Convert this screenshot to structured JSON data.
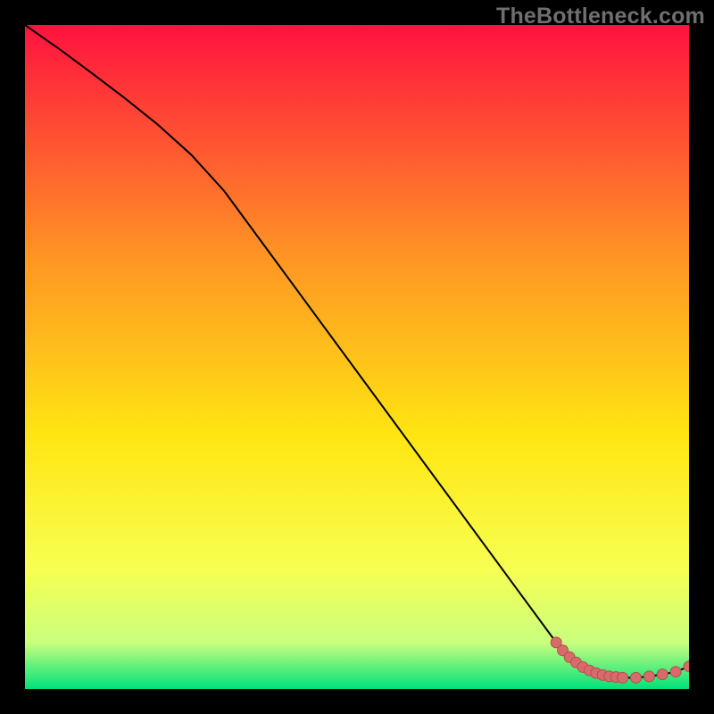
{
  "watermark": "TheBottleneck.com",
  "colors": {
    "gradient_top": "#ff123f",
    "gradient_upper_mid": "#ff9524",
    "gradient_mid": "#ffe612",
    "gradient_lower_mid": "#f7ff52",
    "gradient_low_band": "#c9ff7e",
    "gradient_bottom": "#00e27a",
    "curve": "#000000",
    "marker_fill": "#d76a6a",
    "marker_stroke": "#b94d4d"
  },
  "chart_data": {
    "type": "line",
    "title": "",
    "xlabel": "",
    "ylabel": "",
    "xlim": [
      0,
      100
    ],
    "ylim": [
      0,
      100
    ],
    "grid": false,
    "legend": false,
    "series": [
      {
        "name": "bottleneck-curve",
        "x": [
          0,
          5,
          10,
          15,
          20,
          25,
          30,
          35,
          40,
          45,
          50,
          55,
          60,
          65,
          70,
          75,
          80,
          82,
          84,
          86,
          88,
          90,
          92,
          94,
          96,
          98,
          100
        ],
        "y": [
          100,
          96.5,
          92.8,
          89.0,
          85.0,
          80.5,
          75.0,
          68.2,
          61.4,
          54.6,
          47.8,
          41.0,
          34.2,
          27.4,
          20.6,
          13.8,
          7.0,
          4.8,
          3.3,
          2.4,
          1.9,
          1.7,
          1.7,
          1.9,
          2.2,
          2.6,
          3.4
        ]
      }
    ],
    "markers": {
      "name": "highlight-region",
      "x": [
        80,
        81,
        82,
        83,
        84,
        85,
        86,
        87,
        88,
        89,
        90,
        92,
        94,
        96,
        98,
        100
      ],
      "y": [
        7.0,
        5.8,
        4.8,
        4.0,
        3.3,
        2.8,
        2.4,
        2.1,
        1.9,
        1.8,
        1.7,
        1.7,
        1.9,
        2.2,
        2.6,
        3.4
      ]
    }
  }
}
